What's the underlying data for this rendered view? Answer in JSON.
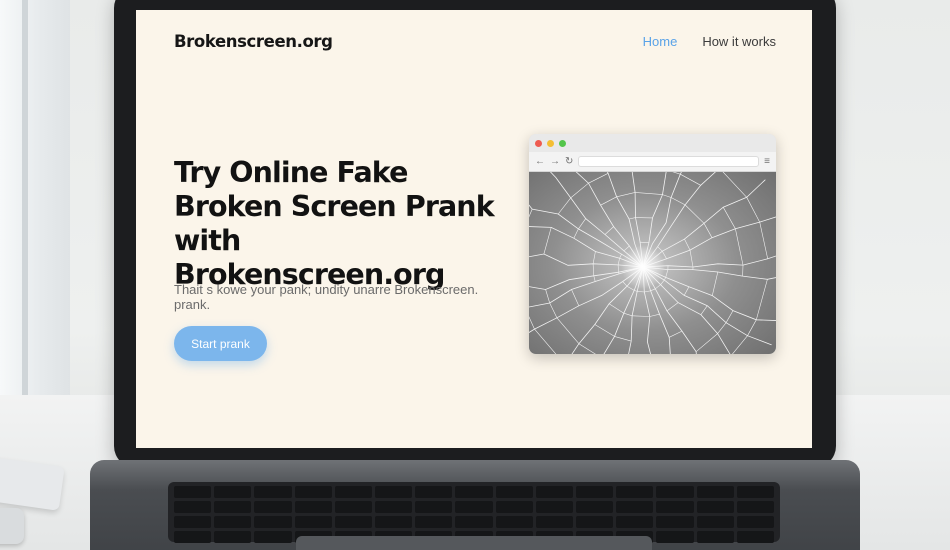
{
  "site": {
    "brand": "Brokenscreen.org"
  },
  "nav": {
    "items": [
      {
        "label": "Home",
        "active": true
      },
      {
        "label": "How it works",
        "active": false
      }
    ]
  },
  "hero": {
    "title": "Try Online Fake Broken Screen Prank with Brokenscreen.org",
    "subtitle": "Thait s kowe your pank; undity unarre Brokenscreen. prank.",
    "cta_label": "Start prank"
  },
  "mockup": {
    "window_buttons": [
      "close",
      "minimize",
      "maximize"
    ],
    "toolbar_icons": [
      "back-arrow-icon",
      "forward-arrow-icon",
      "reload-icon",
      "menu-icon"
    ],
    "image": "cracked-glass"
  },
  "colors": {
    "screen_bg": "#fbf5ea",
    "accent": "#5aa3e8",
    "cta_bg": "#7cb6ec",
    "title_text": "#121212"
  }
}
